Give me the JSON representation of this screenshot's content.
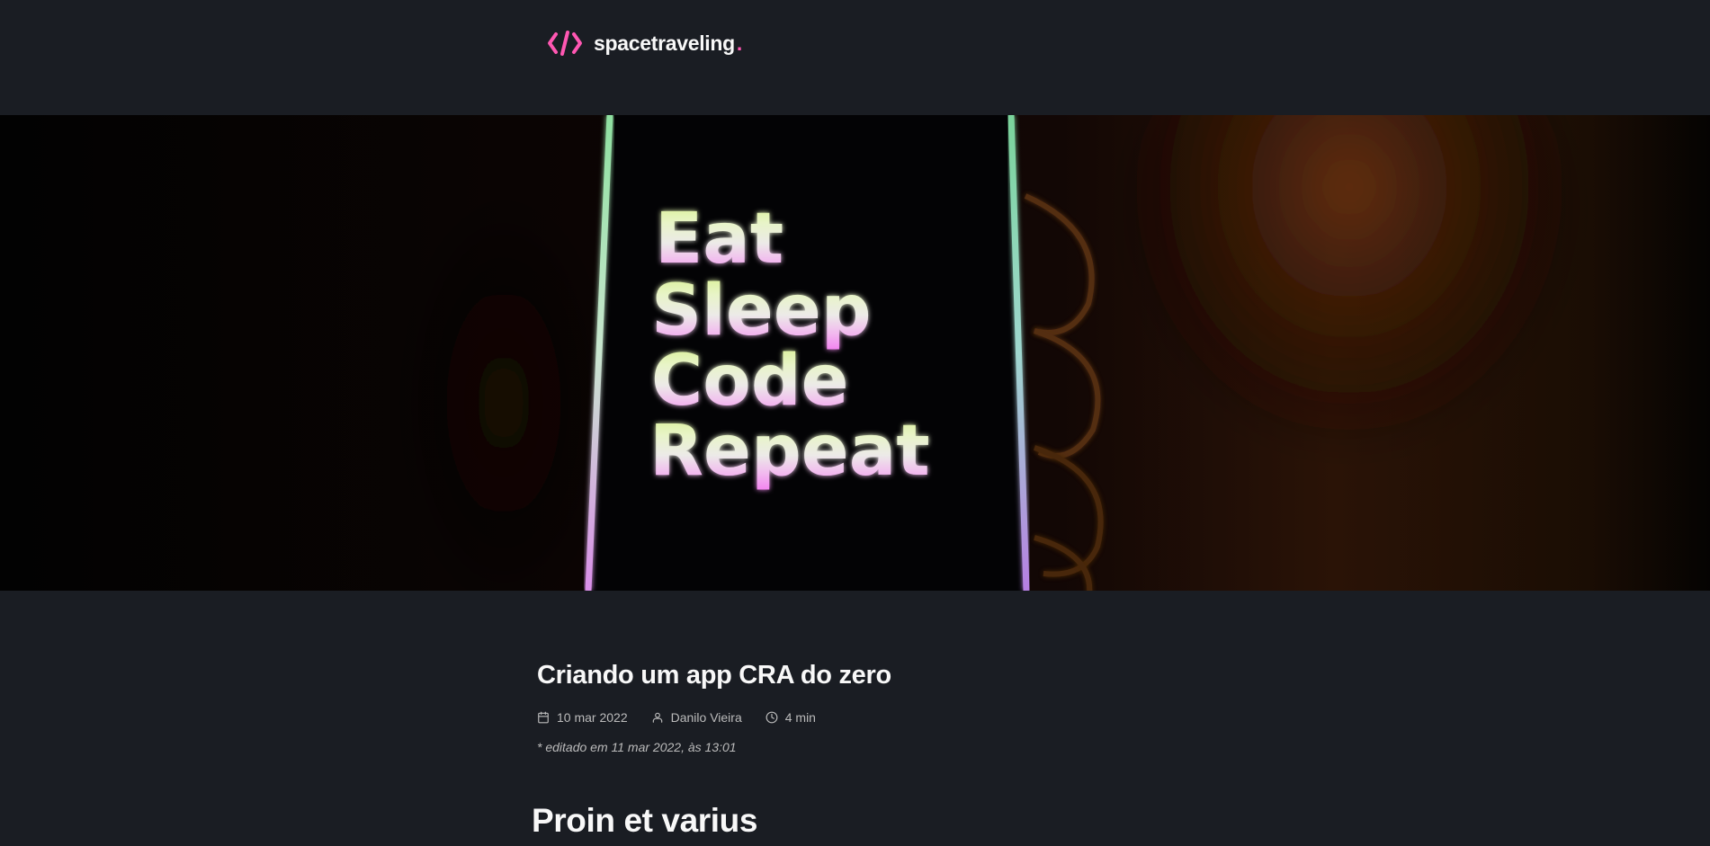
{
  "header": {
    "logo_text": "spacetraveling",
    "logo_dot": ".",
    "logo_icon": "code-brackets-icon",
    "accent_color": "#ff57b2"
  },
  "banner": {
    "lines": [
      "Eat",
      "Sleep",
      "Code",
      "Repeat"
    ]
  },
  "post": {
    "title": "Criando um app CRA do zero",
    "date": "10 mar 2022",
    "author": "Danilo Vieira",
    "reading_time": "4 min",
    "edited": "* editado em 11 mar 2022, às 13:01",
    "icons": {
      "date": "calendar-icon",
      "author": "user-icon",
      "reading_time": "clock-icon"
    }
  },
  "content": {
    "heading": "Proin et varius"
  },
  "colors": {
    "background": "#1a1d23",
    "text": "#f8f8f8",
    "muted": "#bbbbbb"
  }
}
